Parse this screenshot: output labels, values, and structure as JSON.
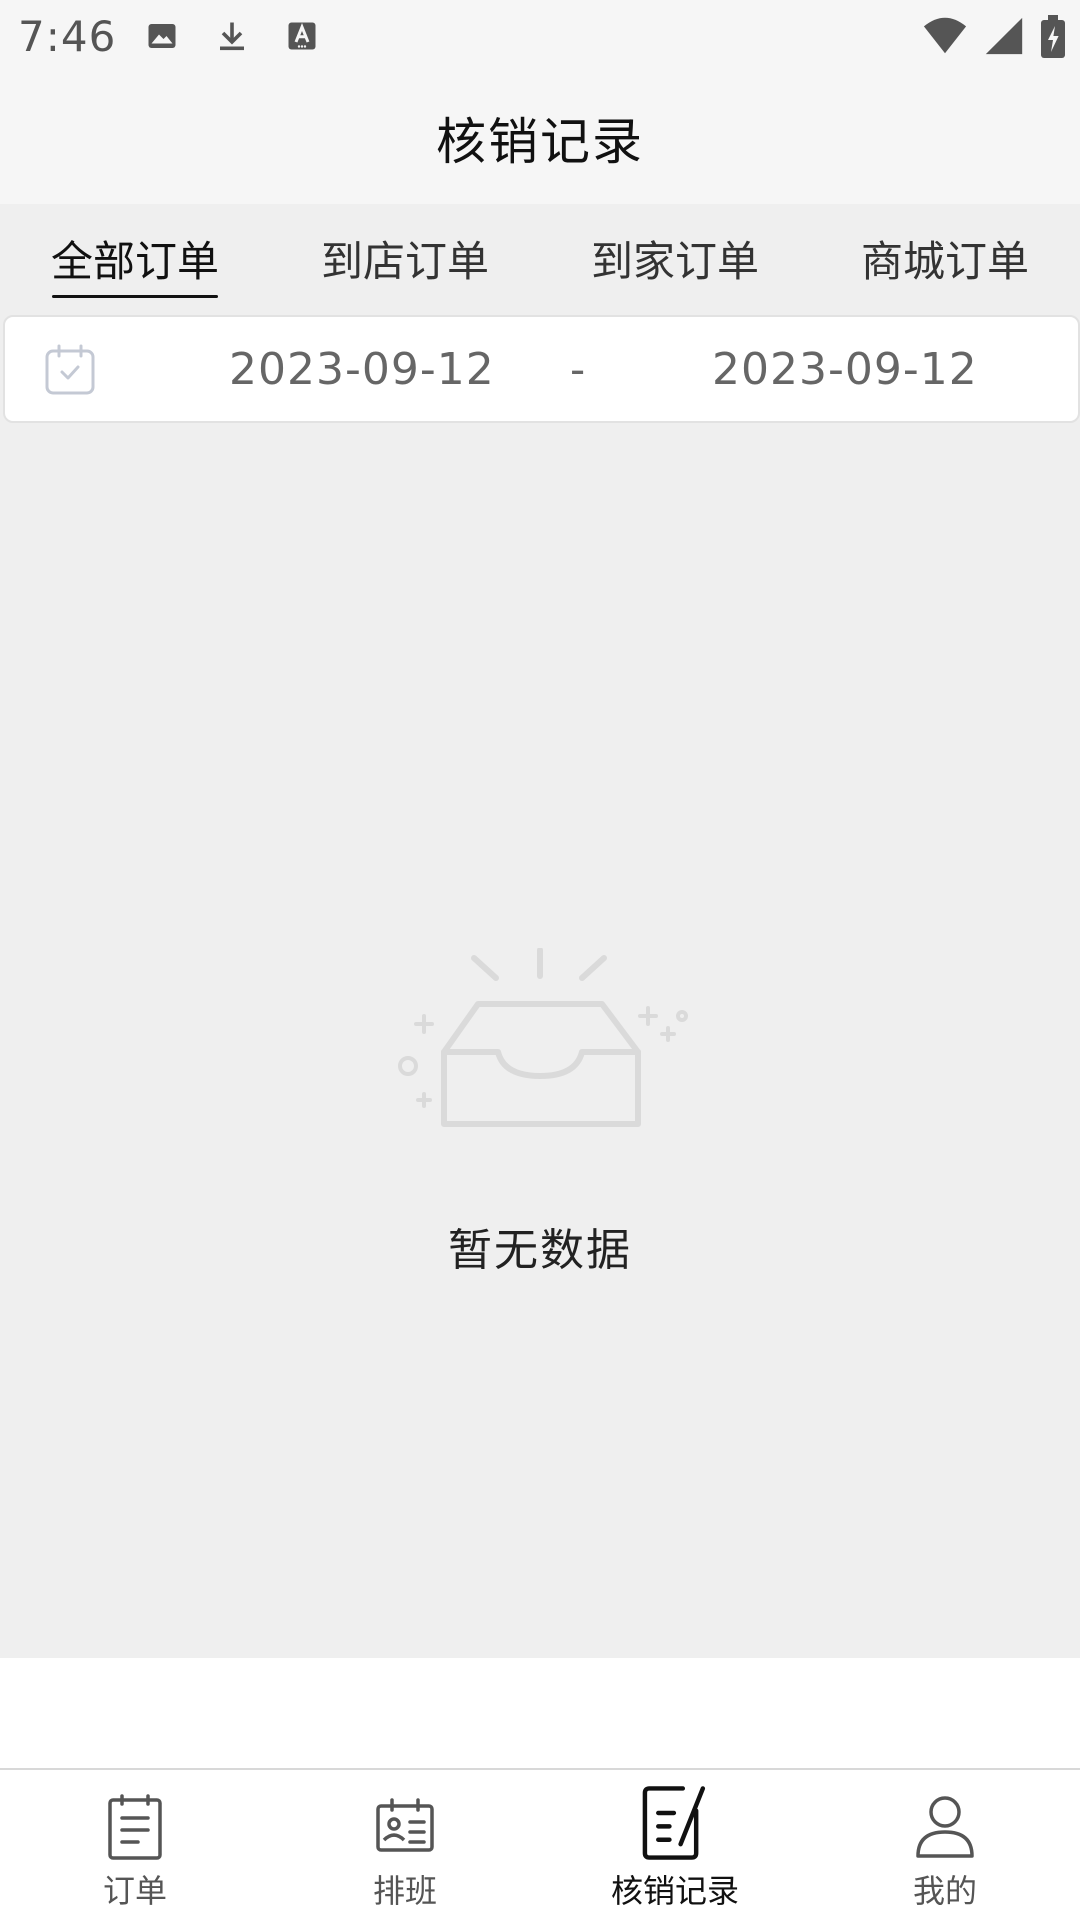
{
  "status_bar": {
    "time": "7:46",
    "left_icons": [
      "image-icon",
      "download-icon",
      "font-a-icon"
    ],
    "right_icons": [
      "wifi-icon",
      "signal-icon",
      "battery-charging-icon"
    ]
  },
  "header": {
    "title": "核销记录"
  },
  "tabs": [
    {
      "label": "全部订单",
      "active": true
    },
    {
      "label": "到店订单",
      "active": false
    },
    {
      "label": "到家订单",
      "active": false
    },
    {
      "label": "商城订单",
      "active": false
    }
  ],
  "date_range": {
    "icon": "calendar-check-icon",
    "start": "2023-09-12",
    "separator": "-",
    "end": "2023-09-12"
  },
  "empty_state": {
    "icon": "empty-box-icon",
    "text": "暂无数据"
  },
  "bottom_nav": [
    {
      "label": "订单",
      "icon": "document-list-icon",
      "active": false
    },
    {
      "label": "排班",
      "icon": "schedule-id-card-icon",
      "active": false
    },
    {
      "label": "核销记录",
      "icon": "note-edit-icon",
      "active": true
    },
    {
      "label": "我的",
      "icon": "user-icon",
      "active": false
    }
  ],
  "colors": {
    "header_bg": "#f6f6f6",
    "content_bg": "#efefef",
    "tab_active_underline": "#111111",
    "icon_gray": "#c8c8c8"
  }
}
